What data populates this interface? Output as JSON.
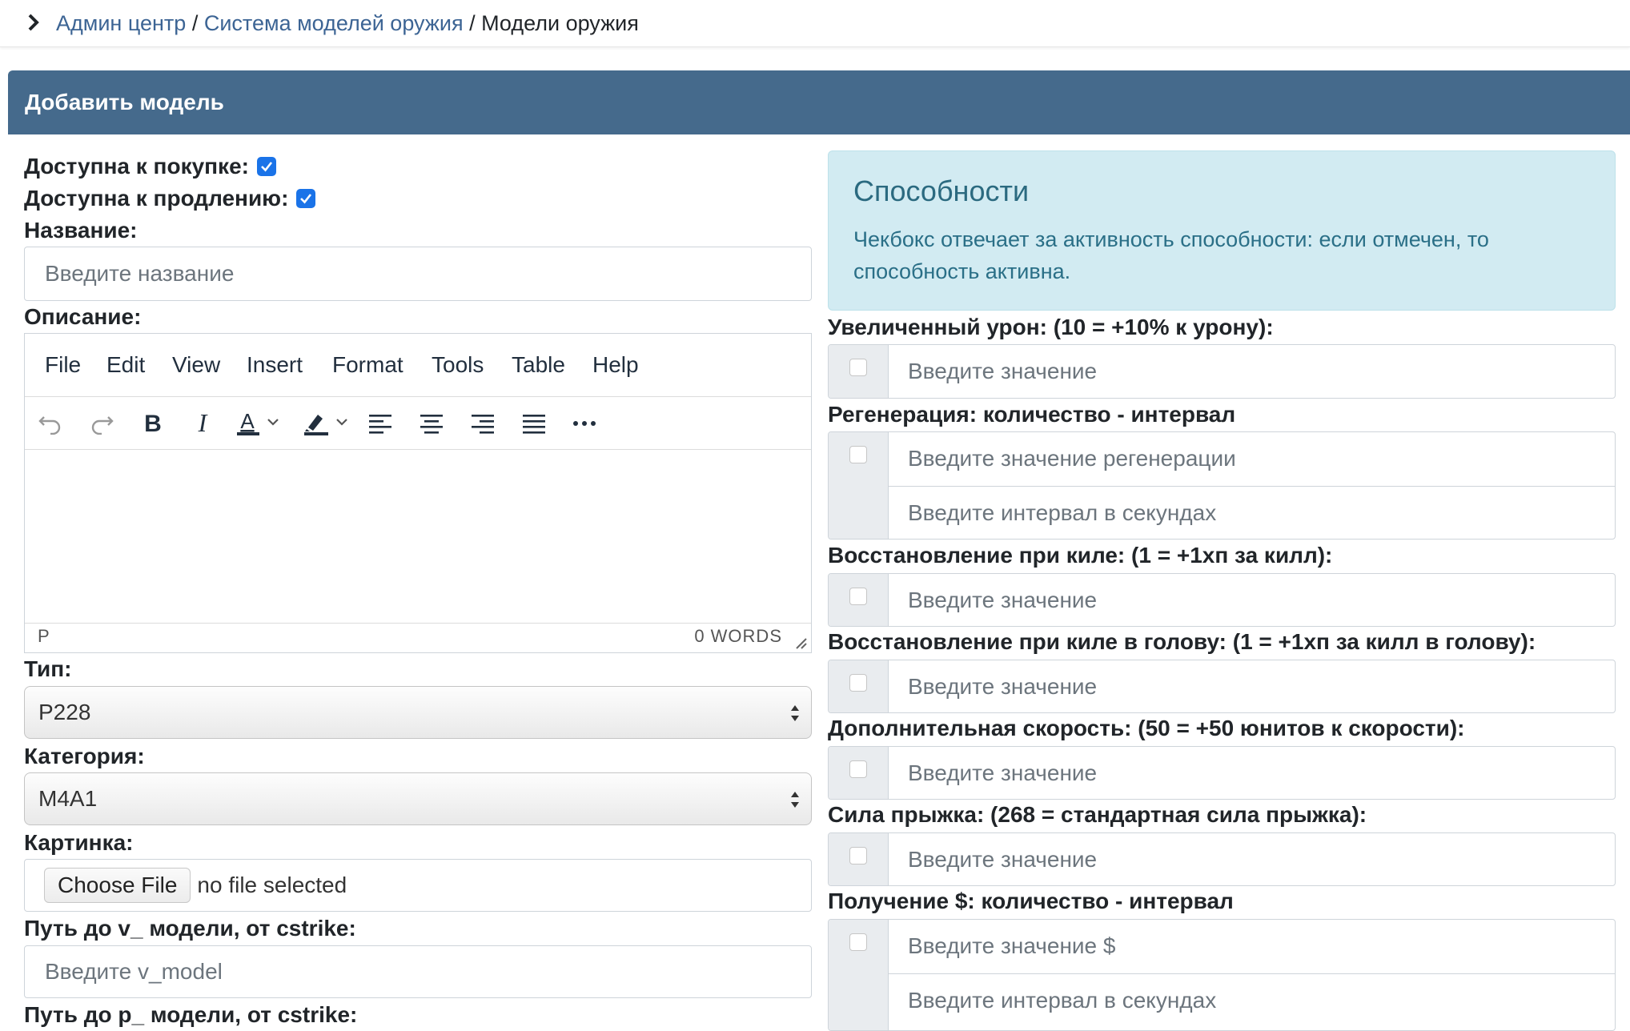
{
  "breadcrumb": {
    "items": [
      {
        "label": "Админ центр",
        "link": true
      },
      {
        "label": "Система моделей оружия",
        "link": true
      },
      {
        "label": "Модели оружия",
        "link": false
      }
    ],
    "separator": "/"
  },
  "card": {
    "title": "Добавить модель"
  },
  "left": {
    "purchase_label": "Доступна к покупке:",
    "purchase_checked": true,
    "renew_label": "Доступна к продлению:",
    "renew_checked": true,
    "name_label": "Название:",
    "name_placeholder": "Введите название",
    "desc_label": "Описание:",
    "editor": {
      "menu": [
        "File",
        "Edit",
        "View",
        "Insert",
        "Format",
        "Tools",
        "Table",
        "Help"
      ],
      "toolbar_icons": [
        "undo-icon",
        "redo-icon",
        "bold-icon",
        "italic-icon",
        "text-color-icon",
        "highlight-color-icon",
        "align-left-icon",
        "align-center-icon",
        "align-right-icon",
        "align-justify-icon",
        "more-icon"
      ],
      "status_path": "P",
      "word_count": "0 WORDS"
    },
    "type_label": "Тип:",
    "type_value": "P228",
    "category_label": "Категория:",
    "category_value": "M4A1",
    "image_label": "Картинка:",
    "file_button": "Choose File",
    "file_status": "no file selected",
    "vmodel_label": "Путь до v_ модели, от cstrike:",
    "vmodel_placeholder": "Введите v_model",
    "pmodel_label": "Путь до p_ модели, от cstrike:"
  },
  "right": {
    "info_title": "Способности",
    "info_text": "Чекбокс отвечает за активность способности: если отмечен, то способность активна.",
    "abilities": [
      {
        "label": "Увеличенный урон: (10 = +10% к урону):",
        "placeholders": [
          "Введите значение"
        ]
      },
      {
        "label": "Регенерация: количество - интервал",
        "placeholders": [
          "Введите значение регенерации",
          "Введите интервал в секундах"
        ]
      },
      {
        "label": "Восстановление при киле: (1 = +1хп за килл):",
        "placeholders": [
          "Введите значение"
        ]
      },
      {
        "label": "Восстановление при киле в голову: (1 = +1хп за килл в голову):",
        "placeholders": [
          "Введите значение"
        ]
      },
      {
        "label": "Дополнительная скорость: (50 = +50 юнитов к скорости):",
        "placeholders": [
          "Введите значение"
        ]
      },
      {
        "label": "Сила прыжка: (268 = стандартная сила прыжка):",
        "placeholders": [
          "Введите значение"
        ]
      },
      {
        "label": "Получение $: количество - интервал",
        "placeholders": [
          "Введите значение $",
          "Введите интервал в секундах"
        ]
      }
    ]
  },
  "colors": {
    "header_bg": "#456a8c",
    "link": "#3c6494",
    "info_bg": "#d2ebf2",
    "checkbox": "#1a73e8"
  }
}
